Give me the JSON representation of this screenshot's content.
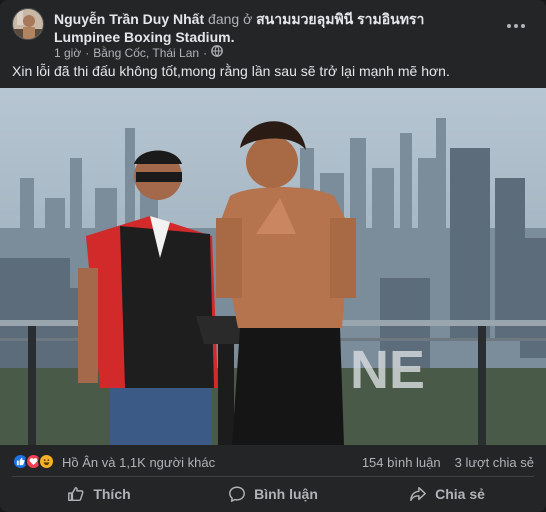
{
  "post": {
    "author": "Nguyễn Trần Duy Nhất",
    "location_prefix": "đang ở",
    "location": "สนามมวยลุมพินี รามอินทรา Lumpinee Boxing Stadium",
    "location_suffix": ".",
    "time": "1 giờ",
    "separator": "·",
    "place": "Bằng Cốc, Thái Lan",
    "separator2": "·",
    "audience_icon": "globe-icon",
    "caption": "Xin lỗi đã thi đấu không tốt,mong rằng lần sau sẽ trở lại mạnh mẽ hơn."
  },
  "photo": {
    "watermark": "NE"
  },
  "reactions": {
    "icons": [
      "like-icon",
      "love-icon",
      "haha-icon"
    ],
    "summary": "Hồ Ân và 1,1K người khác",
    "comments": "154 bình luận",
    "shares": "3 lượt chia sẻ"
  },
  "actions": {
    "like": "Thích",
    "comment": "Bình luận",
    "share": "Chia sẻ"
  },
  "colors": {
    "card": "#242526",
    "text": "#e4e6eb",
    "secondary": "#b0b3b8",
    "like_blue": "#1b74e4",
    "love_red": "#f33e58",
    "haha_yellow": "#f7b125"
  }
}
